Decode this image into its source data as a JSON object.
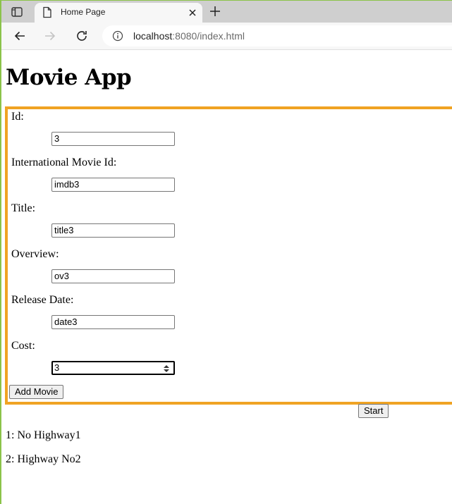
{
  "browser": {
    "tab_title": "Home Page",
    "url_host": "localhost",
    "url_rest": ":8080/index.html"
  },
  "page": {
    "title": "Movie App"
  },
  "form": {
    "fields": [
      {
        "label": "Id:",
        "value": "3"
      },
      {
        "label": "International Movie Id:",
        "value": "imdb3"
      },
      {
        "label": "Title:",
        "value": "title3"
      },
      {
        "label": "Overview:",
        "value": "ov3"
      },
      {
        "label": "Release Date:",
        "value": "date3"
      },
      {
        "label": "Cost:",
        "value": "3"
      }
    ],
    "submit_label": "Add Movie",
    "border_color": "#f0a323"
  },
  "start_button": "Start",
  "movies": [
    "1: No Highway1",
    "2: Highway No2"
  ],
  "icons": [
    "sidebar-toggle-icon",
    "page-icon",
    "close-icon",
    "plus-icon",
    "back-arrow-icon",
    "forward-arrow-icon",
    "reload-icon",
    "info-icon",
    "spinner-arrows-icon"
  ]
}
